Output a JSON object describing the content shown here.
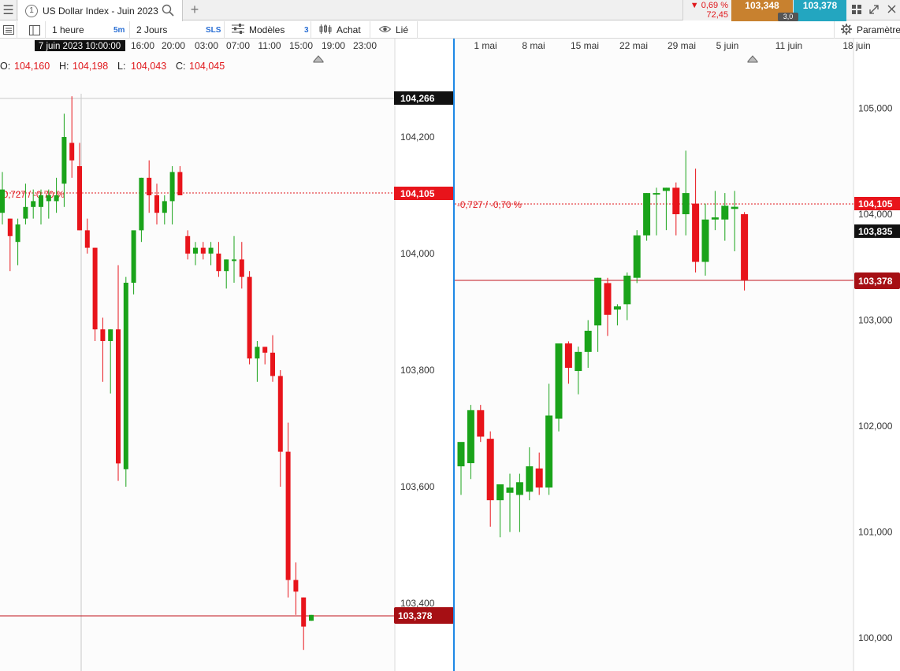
{
  "tabbar": {
    "tab_number": "1",
    "tab_title": "US Dollar Index - Juin 2023",
    "change_pct": "▼ 0,69 %",
    "change_pts": "72,45",
    "bid": "103,348",
    "ask": "103,378",
    "spread": "3,0"
  },
  "toolbar": {
    "interval": "1 heure",
    "interval_badge": "5m",
    "range": "2 Jours",
    "range_badge": "SLS",
    "models": "Modèles",
    "models_badge": "3",
    "buy": "Achat",
    "linked": "Lié",
    "settings": "Paramètre"
  },
  "colors": {
    "up": "#1aa31a",
    "down": "#e8141b",
    "accent_blue": "#1e88e5",
    "bid_bg": "#c8812f",
    "ask_bg": "#23a6c0",
    "price_line": "#c0141c"
  },
  "left_chart": {
    "crosshair_time": "7 juin 2023 10:00:00",
    "time_labels": [
      "16:00",
      "20:00",
      "03:00",
      "07:00",
      "11:00",
      "15:00",
      "19:00",
      "23:00"
    ],
    "ohlc": {
      "o_label": "O:",
      "o": "104,160",
      "h_label": "H:",
      "h": "104,198",
      "l_label": "L:",
      "l": "104,043",
      "c_label": "C:",
      "c": "104,045"
    },
    "change_label": "-0,727 / -0,70 %",
    "axis_labels": [
      "104,200",
      "104,000",
      "103,800",
      "103,600",
      "103,400"
    ],
    "crosshair_price": "104,266",
    "ref_price": "104,105",
    "last_price": "103,378"
  },
  "right_chart": {
    "time_labels": [
      "1 mai",
      "8 mai",
      "15 mai",
      "22 mai",
      "29 mai",
      "5 juin",
      "11 juin",
      "18 juin"
    ],
    "change_label": "-0,727 / -0,70 %",
    "axis_labels": [
      "105,000",
      "104,000",
      "103,000",
      "102,000",
      "101,000",
      "100,000"
    ],
    "ref_price": "104,105",
    "prev_price": "103,835",
    "last_price": "103,378"
  },
  "chart_data": [
    {
      "type": "candlestick",
      "title": "US Dollar Index - Juin 2023",
      "timeframe": "1 heure",
      "ylim": [
        103.3,
        104.33
      ],
      "candles": [
        {
          "o": 104.07,
          "h": 104.14,
          "l": 104.05,
          "c": 104.11
        },
        {
          "o": 104.06,
          "h": 104.06,
          "l": 103.97,
          "c": 104.03
        },
        {
          "o": 104.02,
          "h": 104.06,
          "l": 103.98,
          "c": 104.05
        },
        {
          "o": 104.06,
          "h": 104.12,
          "l": 104.05,
          "c": 104.08
        },
        {
          "o": 104.08,
          "h": 104.11,
          "l": 104.06,
          "c": 104.09
        },
        {
          "o": 104.08,
          "h": 104.11,
          "l": 104.05,
          "c": 104.1
        },
        {
          "o": 104.09,
          "h": 104.11,
          "l": 104.06,
          "c": 104.1
        },
        {
          "o": 104.09,
          "h": 104.13,
          "l": 104.07,
          "c": 104.1
        },
        {
          "o": 104.12,
          "h": 104.24,
          "l": 104.08,
          "c": 104.2
        },
        {
          "o": 104.19,
          "h": 104.27,
          "l": 104.13,
          "c": 104.16
        },
        {
          "o": 104.15,
          "h": 104.19,
          "l": 104.04,
          "c": 104.04
        },
        {
          "o": 104.04,
          "h": 104.06,
          "l": 104.0,
          "c": 104.01
        },
        {
          "o": 104.01,
          "h": 104.01,
          "l": 103.85,
          "c": 103.87
        },
        {
          "o": 103.87,
          "h": 103.89,
          "l": 103.78,
          "c": 103.85
        },
        {
          "o": 103.85,
          "h": 103.87,
          "l": 103.76,
          "c": 103.87
        },
        {
          "o": 103.87,
          "h": 103.98,
          "l": 103.61,
          "c": 103.64
        },
        {
          "o": 103.63,
          "h": 103.96,
          "l": 103.6,
          "c": 103.95
        },
        {
          "o": 103.95,
          "h": 104.01,
          "l": 103.93,
          "c": 104.04
        },
        {
          "o": 104.04,
          "h": 104.13,
          "l": 104.02,
          "c": 104.13
        },
        {
          "o": 104.13,
          "h": 104.16,
          "l": 104.07,
          "c": 104.1
        },
        {
          "o": 104.1,
          "h": 104.12,
          "l": 104.05,
          "c": 104.07
        },
        {
          "o": 104.07,
          "h": 104.1,
          "l": 104.05,
          "c": 104.09
        },
        {
          "o": 104.09,
          "h": 104.15,
          "l": 104.05,
          "c": 104.14
        },
        {
          "o": 104.14,
          "h": 104.15,
          "l": 104.1,
          "c": 104.1
        },
        {
          "o": 104.03,
          "h": 104.04,
          "l": 103.99,
          "c": 104.0
        },
        {
          "o": 104.0,
          "h": 104.02,
          "l": 103.98,
          "c": 104.01
        },
        {
          "o": 104.01,
          "h": 104.02,
          "l": 103.99,
          "c": 104.0
        },
        {
          "o": 104.0,
          "h": 104.02,
          "l": 103.98,
          "c": 104.01
        },
        {
          "o": 104.0,
          "h": 104.02,
          "l": 103.96,
          "c": 103.97
        },
        {
          "o": 103.97,
          "h": 103.99,
          "l": 103.94,
          "c": 103.99
        },
        {
          "o": 103.99,
          "h": 104.03,
          "l": 103.95,
          "c": 103.99
        },
        {
          "o": 103.99,
          "h": 104.02,
          "l": 103.94,
          "c": 103.96
        },
        {
          "o": 103.96,
          "h": 103.97,
          "l": 103.81,
          "c": 103.82
        },
        {
          "o": 103.82,
          "h": 103.85,
          "l": 103.78,
          "c": 103.84
        },
        {
          "o": 103.84,
          "h": 103.84,
          "l": 103.81,
          "c": 103.83
        },
        {
          "o": 103.83,
          "h": 103.86,
          "l": 103.78,
          "c": 103.79
        },
        {
          "o": 103.79,
          "h": 103.8,
          "l": 103.6,
          "c": 103.66
        },
        {
          "o": 103.66,
          "h": 103.71,
          "l": 103.41,
          "c": 103.44
        },
        {
          "o": 103.44,
          "h": 103.47,
          "l": 103.38,
          "c": 103.42
        },
        {
          "o": 103.41,
          "h": 103.41,
          "l": 103.32,
          "c": 103.36
        },
        {
          "o": 103.37,
          "h": 103.38,
          "l": 103.37,
          "c": 103.38
        }
      ]
    },
    {
      "type": "candlestick",
      "title": "US Dollar Index - Juin 2023",
      "timeframe": "daily",
      "ylim": [
        99.8,
        105.5
      ],
      "candles": [
        {
          "o": 101.62,
          "h": 101.8,
          "l": 101.35,
          "c": 101.85
        },
        {
          "o": 101.65,
          "h": 102.2,
          "l": 101.5,
          "c": 102.15
        },
        {
          "o": 102.15,
          "h": 102.2,
          "l": 101.85,
          "c": 101.9
        },
        {
          "o": 101.88,
          "h": 101.95,
          "l": 101.05,
          "c": 101.3
        },
        {
          "o": 101.3,
          "h": 101.4,
          "l": 100.95,
          "c": 101.45
        },
        {
          "o": 101.37,
          "h": 101.55,
          "l": 101.0,
          "c": 101.42
        },
        {
          "o": 101.35,
          "h": 101.55,
          "l": 101.0,
          "c": 101.47
        },
        {
          "o": 101.38,
          "h": 101.8,
          "l": 101.3,
          "c": 101.62
        },
        {
          "o": 101.6,
          "h": 101.75,
          "l": 101.35,
          "c": 101.42
        },
        {
          "o": 101.42,
          "h": 102.4,
          "l": 101.35,
          "c": 102.1
        },
        {
          "o": 102.07,
          "h": 102.75,
          "l": 101.95,
          "c": 102.78
        },
        {
          "o": 102.78,
          "h": 102.8,
          "l": 102.4,
          "c": 102.55
        },
        {
          "o": 102.52,
          "h": 102.75,
          "l": 102.3,
          "c": 102.7
        },
        {
          "o": 102.7,
          "h": 103.0,
          "l": 102.55,
          "c": 102.9
        },
        {
          "o": 102.95,
          "h": 103.4,
          "l": 102.7,
          "c": 103.4
        },
        {
          "o": 103.35,
          "h": 103.4,
          "l": 102.85,
          "c": 103.05
        },
        {
          "o": 103.1,
          "h": 103.15,
          "l": 102.95,
          "c": 103.13
        },
        {
          "o": 103.15,
          "h": 103.45,
          "l": 103.0,
          "c": 103.42
        },
        {
          "o": 103.4,
          "h": 103.85,
          "l": 103.35,
          "c": 103.8
        },
        {
          "o": 103.8,
          "h": 104.2,
          "l": 103.75,
          "c": 104.2
        },
        {
          "o": 104.2,
          "h": 104.25,
          "l": 103.8,
          "c": 104.2
        },
        {
          "o": 104.22,
          "h": 104.25,
          "l": 103.85,
          "c": 104.25
        },
        {
          "o": 104.25,
          "h": 104.3,
          "l": 103.8,
          "c": 104.0
        },
        {
          "o": 104.0,
          "h": 104.6,
          "l": 103.8,
          "c": 104.2
        },
        {
          "o": 104.1,
          "h": 104.43,
          "l": 103.45,
          "c": 103.55
        },
        {
          "o": 103.55,
          "h": 104.1,
          "l": 103.42,
          "c": 103.95
        },
        {
          "o": 103.95,
          "h": 104.22,
          "l": 103.85,
          "c": 103.97
        },
        {
          "o": 103.95,
          "h": 104.2,
          "l": 103.75,
          "c": 104.08
        },
        {
          "o": 104.05,
          "h": 104.22,
          "l": 103.65,
          "c": 104.07
        },
        {
          "o": 104.0,
          "h": 104.02,
          "l": 103.28,
          "c": 103.38
        }
      ]
    }
  ]
}
